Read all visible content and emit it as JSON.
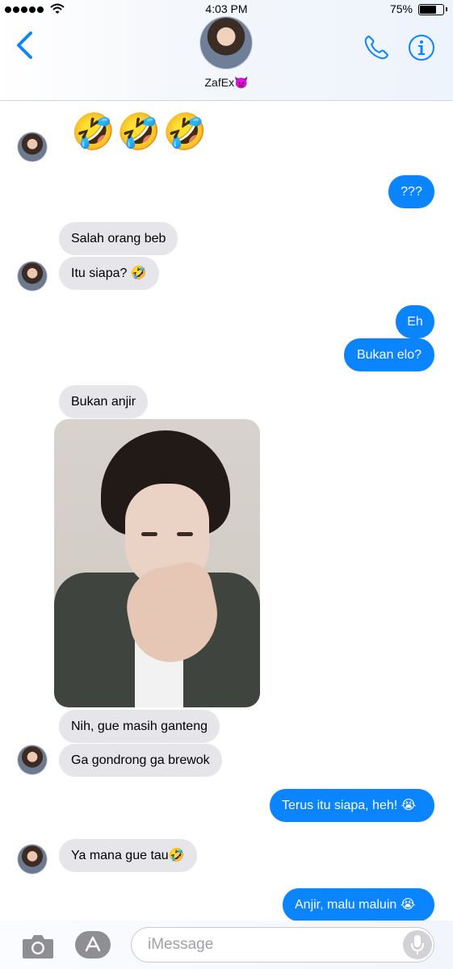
{
  "status_bar": {
    "time": "4:03 PM",
    "battery_percent": "75%",
    "battery_level": 0.75
  },
  "header": {
    "contact_name": "ZafEx👿"
  },
  "messages": [
    {
      "side": "in",
      "text": "🤣🤣🤣"
    },
    {
      "side": "out",
      "text": "???"
    },
    {
      "side": "in",
      "text": "Salah orang beb"
    },
    {
      "side": "in",
      "text": "Itu siapa? 🤣"
    },
    {
      "side": "out",
      "text": "Eh"
    },
    {
      "side": "out",
      "text": "Bukan elo?"
    },
    {
      "side": "in",
      "text": "Bukan anjir"
    },
    {
      "side": "in",
      "type": "photo"
    },
    {
      "side": "in",
      "text": "Nih, gue masih ganteng"
    },
    {
      "side": "in",
      "text": "Ga gondrong ga brewok"
    },
    {
      "side": "out",
      "text": "Terus itu siapa, heh! 😭"
    },
    {
      "side": "in",
      "text": "Ya mana gue tau🤣"
    },
    {
      "side": "out",
      "text": "Anjir, malu maluin 😭"
    }
  ],
  "input": {
    "placeholder": "iMessage"
  },
  "colors": {
    "accent": "#0b84ff",
    "incoming_bubble": "#e5e5ea"
  }
}
